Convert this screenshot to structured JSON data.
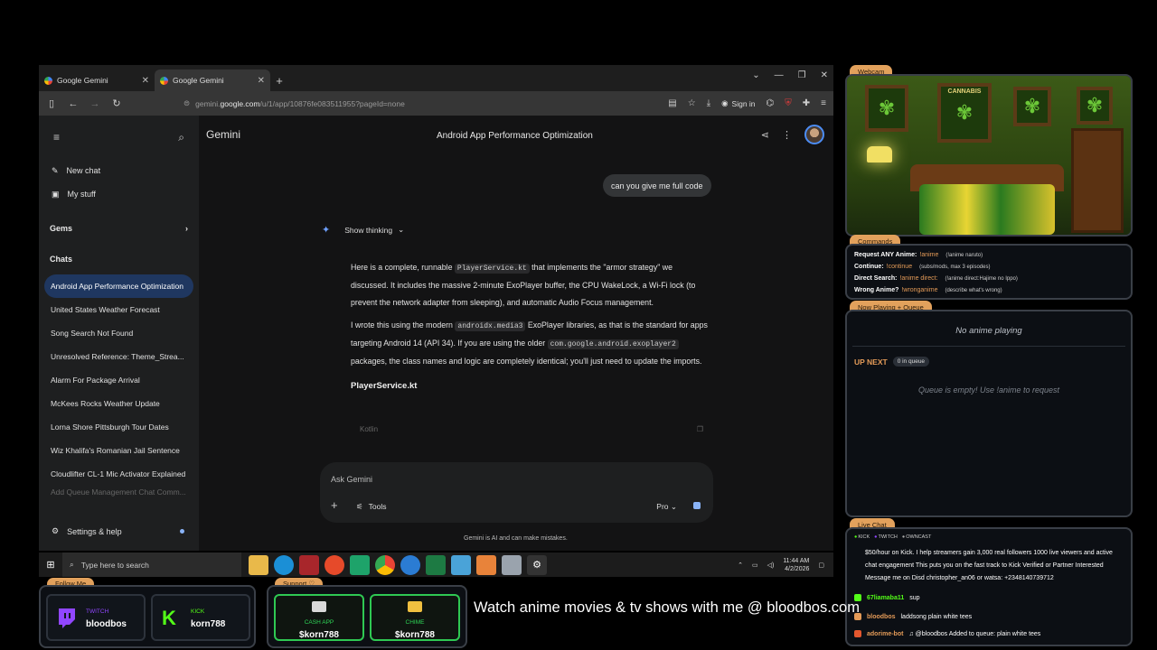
{
  "browser": {
    "tabs": [
      {
        "title": "Google Gemini",
        "active": false
      },
      {
        "title": "Google Gemini",
        "active": true
      }
    ],
    "new_tab": "+",
    "url_prefix": "gemini.",
    "url_domain": "google.com",
    "url_path": "/u/1/app/10876fe083511955?pageId=none",
    "sign_in": "Sign in"
  },
  "sidebar": {
    "new_chat": "New chat",
    "my_stuff": "My stuff",
    "gems": "Gems",
    "chats": "Chats",
    "chat_items": [
      "Android App Performance Optimization",
      "United States Weather Forecast",
      "Song Search Not Found",
      "Unresolved Reference: Theme_Strea...",
      "Alarm For Package Arrival",
      "McKees Rocks Weather Update",
      "Lorna Shore Pittsburgh Tour Dates",
      "Wiz Khalifa's Romanian Jail Sentence",
      "Cloudlifter CL-1 Mic Activator Explained",
      "Add Queue Management Chat Comm..."
    ],
    "settings": "Settings & help"
  },
  "main": {
    "brand": "Gemini",
    "title": "Android App Performance Optimization",
    "user_message": "can you give me full code",
    "show_thinking": "Show thinking",
    "para1_a": "Here is a complete, runnable ",
    "para1_code": "PlayerService.kt",
    "para1_b": " that implements the \"armor strategy\" we discussed. It includes the massive 2-minute ExoPlayer buffer, the CPU WakeLock, a Wi-Fi lock (to prevent the network adapter from sleeping), and automatic Audio Focus management.",
    "para2_a": "I wrote this using the modern ",
    "para2_code1": "androidx.media3",
    "para2_b": " ExoPlayer libraries, as that is the standard for apps targeting Android 14 (API 34). If you are using the older ",
    "para2_code2": "com.google.android.exoplayer2",
    "para2_c": " packages, the class names and logic are completely identical; you'll just need to update the imports.",
    "heading": "PlayerService.kt",
    "code_lang": "Kotlin",
    "input_placeholder": "Ask Gemini",
    "tools": "Tools",
    "model": "Pro",
    "disclaimer": "Gemini is AI and can make mistakes."
  },
  "taskbar": {
    "search": "Type here to search",
    "time": "11:44 AM",
    "date": "4/2/2026"
  },
  "overlay": {
    "webcam_tag": "Webcam",
    "poster_caption": "CANNABIS",
    "commands_tag": "Commands",
    "commands": [
      {
        "label": "Request ANY Anime:",
        "cmd": "!anime",
        "desc": "(!anime naruto)"
      },
      {
        "label": "Continue:",
        "cmd": "!continue",
        "desc": "(subs/mods, max 3 episodes)"
      },
      {
        "label": "Direct Search:",
        "cmd": "!anime direct:",
        "desc": "(!anime direct:Hajime no Ippo)"
      },
      {
        "label": "Wrong Anime?",
        "cmd": "!wronganime",
        "desc": "(describe what's wrong)"
      }
    ],
    "queue_tag": "Now Playing + Queue",
    "no_anime": "No anime playing",
    "up_next": "UP NEXT",
    "queue_count": "0 in queue",
    "queue_empty": "Queue is empty! Use !anime to request",
    "chat_tag": "Live Chat",
    "platforms": [
      "KICK",
      "TWITCH",
      "OWNCAST"
    ],
    "chat": [
      {
        "text": "$50/hour on Kick. I help streamers gain 3,000 real followers 1000 live viewers and active chat engagement This puts you on the fast track to Kick Verified or Partner Interested Message me on Disd christopher_an06 or watsa: +2348140739712"
      },
      {
        "user": "67liamaba11",
        "text": "sup",
        "color": "#53fc18"
      },
      {
        "user": "bloodbos",
        "text": "laddsong plain white tees",
        "color": "#e49b58"
      },
      {
        "user": "adorime-bot",
        "text": "♫ @bloodbos Added to queue: plain white tees",
        "color": "#e49b58"
      }
    ],
    "follow_tag": "Follow Me",
    "follow": [
      {
        "platform": "TWITCH",
        "handle": "bloodbos",
        "color": "#9146ff"
      },
      {
        "platform": "KICK",
        "handle": "korn788",
        "color": "#53fc18"
      }
    ],
    "support_tag": "Support ♡",
    "support": [
      {
        "label": "CASH APP",
        "handle": "$korn788"
      },
      {
        "label": "CHIME",
        "handle": "$korn788"
      }
    ],
    "ticker": "Watch anime movies & tv shows with me @ bloodbos.com"
  },
  "colors": {
    "accent": "#e2a15c",
    "kick": "#53fc18",
    "twitch": "#9146ff",
    "gemini_blue": "#8ab4f8",
    "active_chat": "#1f3760"
  }
}
